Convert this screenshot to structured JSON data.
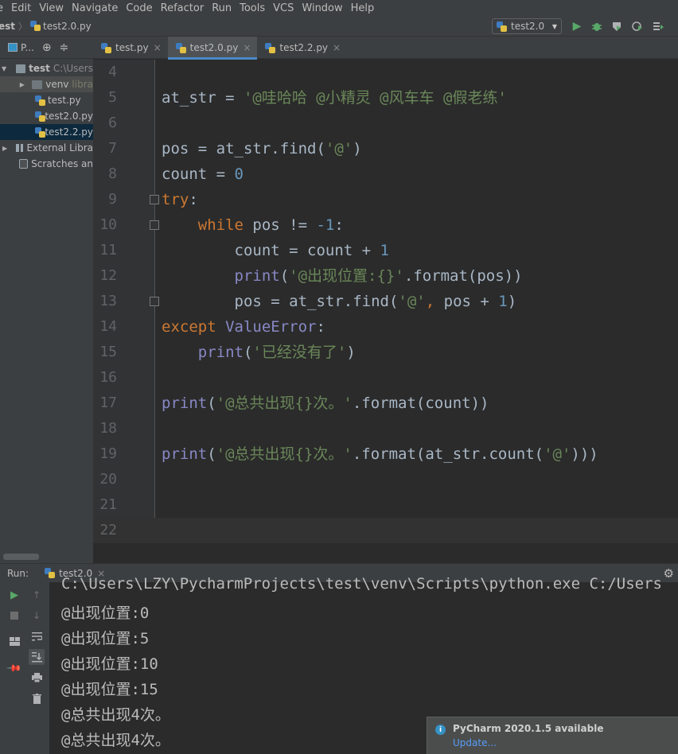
{
  "menu": [
    "e",
    "Edit",
    "View",
    "Navigate",
    "Code",
    "Refactor",
    "Run",
    "Tools",
    "VCS",
    "Window",
    "Help"
  ],
  "breadcrumb": {
    "project": "est",
    "file": "test2.0.py"
  },
  "run_config": {
    "name": "test2.0"
  },
  "project_panel": {
    "title": "P..."
  },
  "tree": {
    "root": "test",
    "root_path": "C:\\Users",
    "venv": "venv",
    "venv_hint": "libra",
    "files": [
      "test.py",
      "test2.0.py",
      "test2.2.py"
    ],
    "external": "External Libra",
    "scratches": "Scratches an"
  },
  "tabs": [
    {
      "label": "test.py",
      "active": false
    },
    {
      "label": "test2.0.py",
      "active": true
    },
    {
      "label": "test2.2.py",
      "active": false
    }
  ],
  "line_numbers": [
    "4",
    "5",
    "6",
    "7",
    "8",
    "9",
    "10",
    "11",
    "12",
    "13",
    "14",
    "15",
    "16",
    "17",
    "18",
    "19",
    "20",
    "21",
    "22"
  ],
  "run_panel": {
    "label": "Run:",
    "tab": "test2.0",
    "command": "C:\\Users\\LZY\\PycharmProjects\\test\\venv\\Scripts\\python.exe C:/Users",
    "output": [
      "@出现位置:0",
      "@出现位置:5",
      "@出现位置:10",
      "@出现位置:15",
      "@总共出现4次。",
      "@总共出现4次。"
    ]
  },
  "notification": {
    "title": "PyCharm 2020.1.5 available",
    "link": "Update..."
  },
  "colors": {
    "keyword": "#cc7832",
    "number": "#6897bb",
    "string": "#6a8759",
    "builtin": "#8888c6",
    "selection": "#0d293e"
  }
}
